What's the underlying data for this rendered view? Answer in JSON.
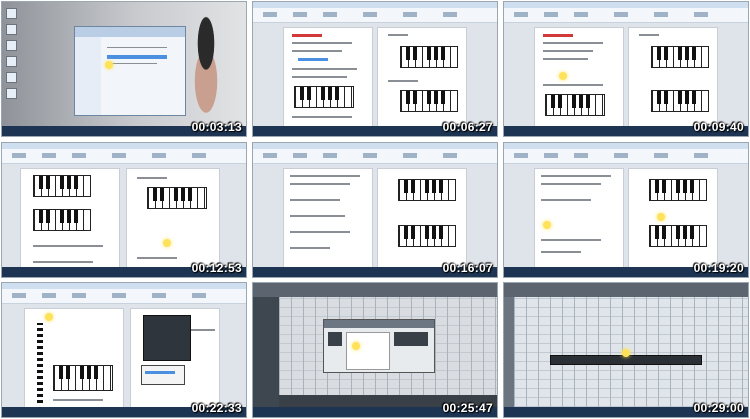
{
  "thumbnails": [
    {
      "timestamp": "00:03:13",
      "scene": "desktop-explorer"
    },
    {
      "timestamp": "00:06:27",
      "scene": "word-piano"
    },
    {
      "timestamp": "00:09:40",
      "scene": "word-piano"
    },
    {
      "timestamp": "00:12:53",
      "scene": "word-piano"
    },
    {
      "timestamp": "00:16:07",
      "scene": "word-piano"
    },
    {
      "timestamp": "00:19:20",
      "scene": "word-piano"
    },
    {
      "timestamp": "00:22:33",
      "scene": "word-dialog"
    },
    {
      "timestamp": "00:25:47",
      "scene": "daw-dialog"
    },
    {
      "timestamp": "00:29:00",
      "scene": "daw-grid"
    }
  ],
  "colors": {
    "timestamp_text": "#ffffff",
    "taskbar": "#1d3553",
    "highlight_cursor": "#ffe25a",
    "heading_red": "#d23a3a"
  },
  "icons": {
    "cursor_highlight": "yellow-circle",
    "desktop_items": "document-icon"
  }
}
